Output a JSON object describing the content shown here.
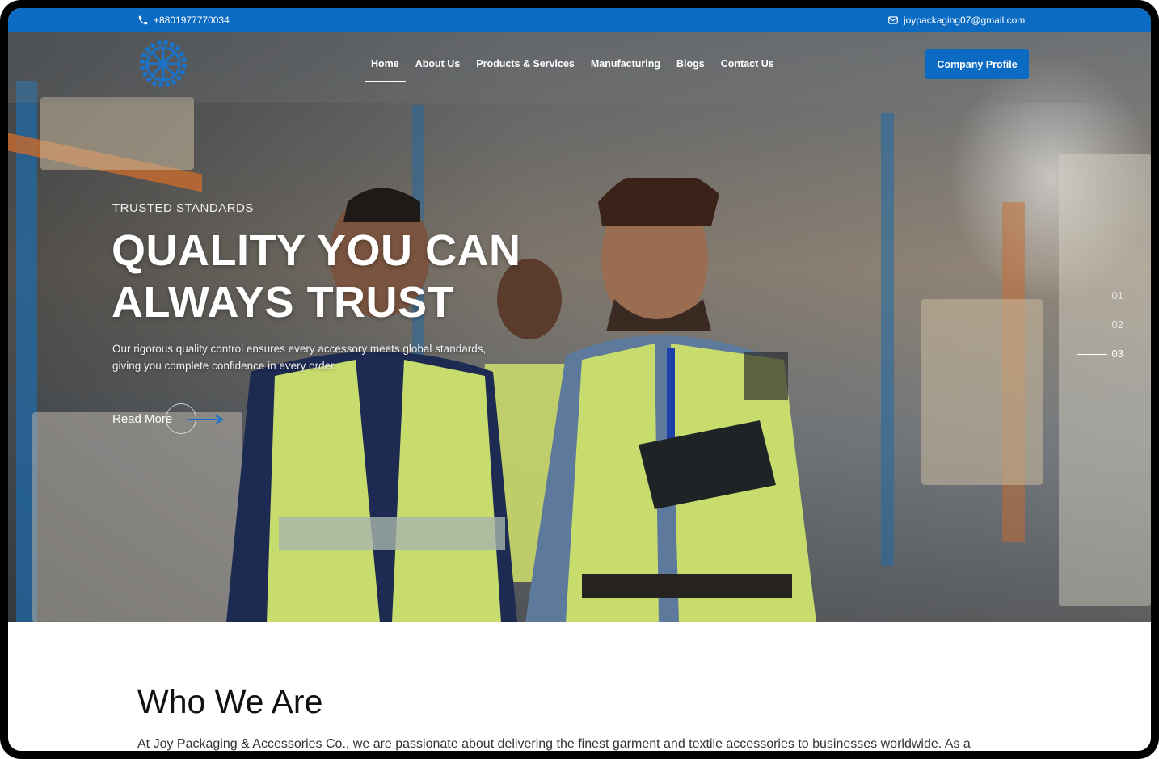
{
  "topbar": {
    "phone": "+8801977770034",
    "email": "joypackaging07@gmail.com",
    "phone_icon": "phone-icon",
    "email_icon": "envelope-icon"
  },
  "nav": {
    "logo_icon": "gear-wheel-logo",
    "items": [
      {
        "label": "Home",
        "active": true
      },
      {
        "label": "About Us"
      },
      {
        "label": "Products & Services"
      },
      {
        "label": "Manufacturing"
      },
      {
        "label": "Blogs"
      },
      {
        "label": "Contact Us"
      }
    ],
    "cta_label": "Company Profile"
  },
  "hero": {
    "eyebrow": "TRUSTED STANDARDS",
    "headline_line1": "QUALITY YOU CAN",
    "headline_line2": "ALWAYS TRUST",
    "description_line1": "Our rigorous quality control ensures every accessory meets global standards,",
    "description_line2": "giving you complete confidence in every order.",
    "read_more": "Read More",
    "slides": [
      "01",
      "02",
      "03"
    ],
    "active_slide": "03"
  },
  "who": {
    "title": "Who We Are",
    "text": "At Joy Packaging & Accessories Co., we are passionate about delivering the finest garment and textile accessories to businesses worldwide. As a"
  },
  "colors": {
    "brand_blue": "#0b6bc2",
    "white": "#ffffff"
  }
}
